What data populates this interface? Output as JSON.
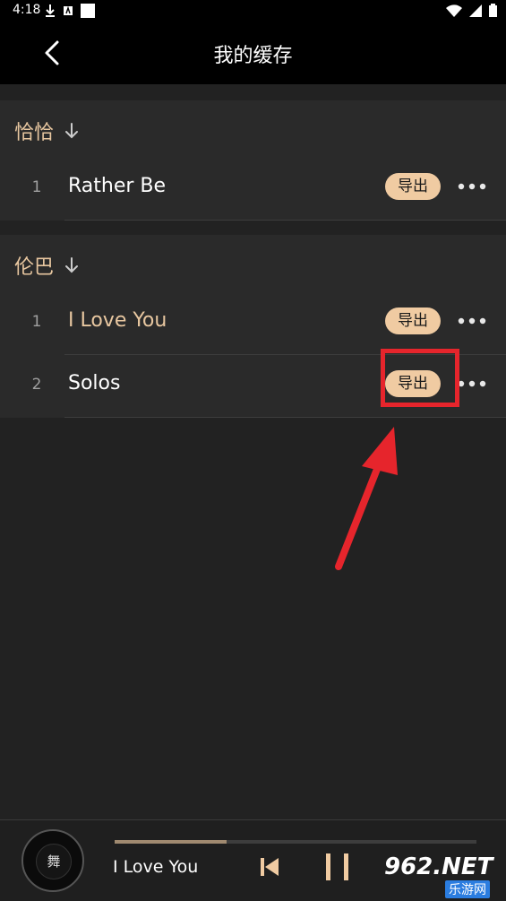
{
  "status_bar": {
    "time": "4:18"
  },
  "header": {
    "title": "我的缓存"
  },
  "sections": [
    {
      "name": "恰恰",
      "songs": [
        {
          "index": "1",
          "title": "Rather Be",
          "export_label": "导出"
        }
      ]
    },
    {
      "name": "伦巴",
      "songs": [
        {
          "index": "1",
          "title": "I Love You",
          "export_label": "导出",
          "playing": true
        },
        {
          "index": "2",
          "title": "Solos",
          "export_label": "导出"
        }
      ]
    }
  ],
  "player": {
    "now_playing": "I Love You",
    "progress": 0.31,
    "disc_label": "舞"
  },
  "watermark": {
    "brand": "962.NET",
    "sub": "乐游网"
  },
  "colors": {
    "accent": "#e8c7a0",
    "export_bg": "#f0cba2",
    "highlight": "#e6252c",
    "background": "#222222"
  }
}
